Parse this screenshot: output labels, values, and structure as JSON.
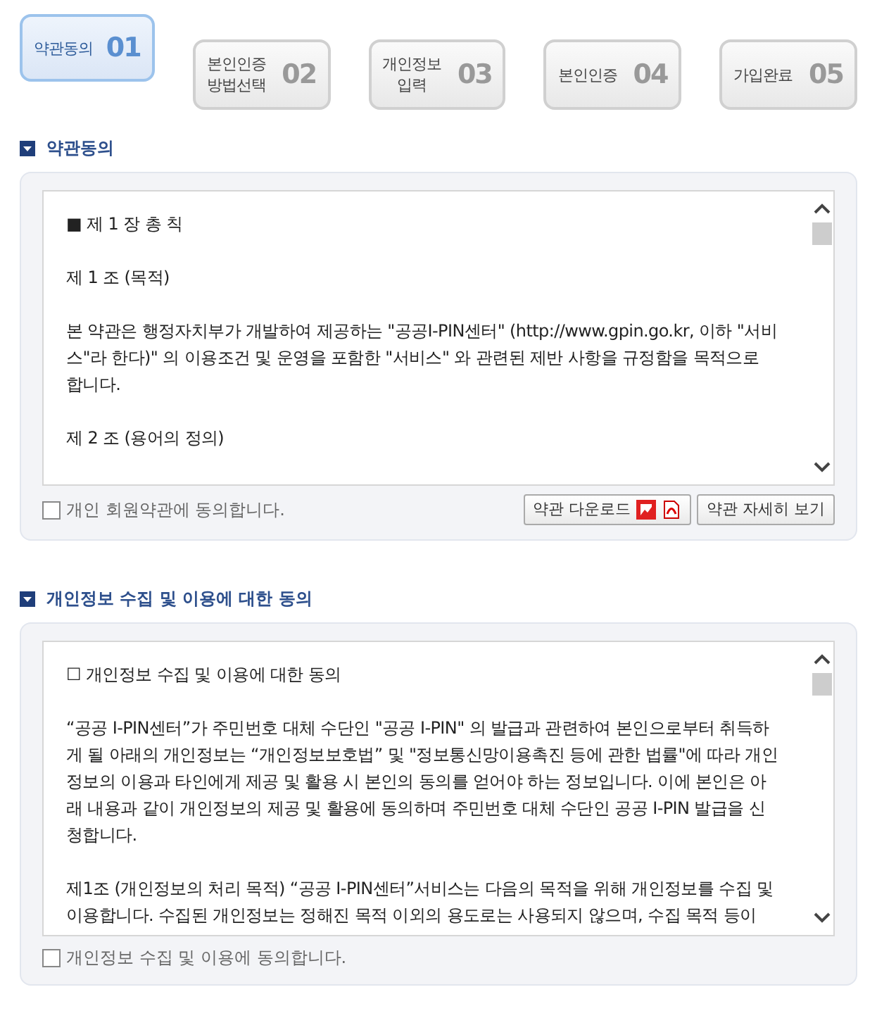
{
  "steps": [
    {
      "label_lines": [
        "약관동의"
      ],
      "number": "01",
      "selected": true
    },
    {
      "label_lines": [
        "본인인증",
        "방법선택"
      ],
      "number": "02",
      "selected": false
    },
    {
      "label_lines": [
        "개인정보",
        "입력"
      ],
      "number": "03",
      "selected": false
    },
    {
      "label_lines": [
        "본인인증"
      ],
      "number": "04",
      "selected": false
    },
    {
      "label_lines": [
        "가입완료"
      ],
      "number": "05",
      "selected": false
    }
  ],
  "sections": [
    {
      "title": "약관동의",
      "paragraphs": [
        {
          "lines": [
            "■ 제 1 장  총 칙"
          ]
        },
        {
          "lines": [
            "제 1 조 (목적)"
          ]
        },
        {
          "lines": [
            "본 약관은 행정자치부가 개발하여 제공하는 \"공공I-PIN센터\" (http://www.gpin.go.kr, 이하 \"서비",
            "스\"라 한다)\" 의 이용조건 및 운영을 포함한 \"서비스\" 와 관련된 제반 사항을 규정함을 목적으로",
            "합니다."
          ]
        },
        {
          "lines": [
            "제 2 조 (용어의 정의)"
          ]
        }
      ],
      "agree_label": "개인 회원약관에 동의합니다.",
      "agree_checked": false,
      "buttons": [
        {
          "kind": "download",
          "label": "약관 다운로드"
        },
        {
          "kind": "plain",
          "label": "약관 자세히 보기"
        }
      ]
    },
    {
      "title": "개인정보 수집 및 이용에 대한 동의",
      "paragraphs": [
        {
          "lines": [
            "☐ 개인정보 수집 및 이용에 대한 동의"
          ]
        },
        {
          "lines": [
            "“공공 I-PIN센터”가 주민번호 대체 수단인 \"공공 I-PIN\" 의 발급과 관련하여 본인으로부터 취득하",
            "게 될 아래의 개인정보는 “개인정보보호법” 및 \"정보통신망이용촉진 등에 관한 법률\"에 따라 개인",
            "정보의 이용과 타인에게 제공 및 활용 시 본인의 동의를 얻어야 하는 정보입니다. 이에 본인은 아",
            "래 내용과 같이 개인정보의 제공 및 활용에 동의하며 주민번호 대체 수단인 공공 I-PIN 발급을 신",
            "청합니다."
          ]
        },
        {
          "lines": [
            "제1조 (개인정보의 처리 목적) “공공 I-PIN센터”서비스는 다음의 목적을 위해 개인정보를 수집 및",
            "이용합니다. 수집된 개인정보는 정해진 목적 이외의 용도로는 사용되지 않으며, 수집 목적 등이"
          ]
        }
      ],
      "agree_label": "개인정보 수집 및 이용에 동의합니다.",
      "agree_checked": false
    }
  ]
}
